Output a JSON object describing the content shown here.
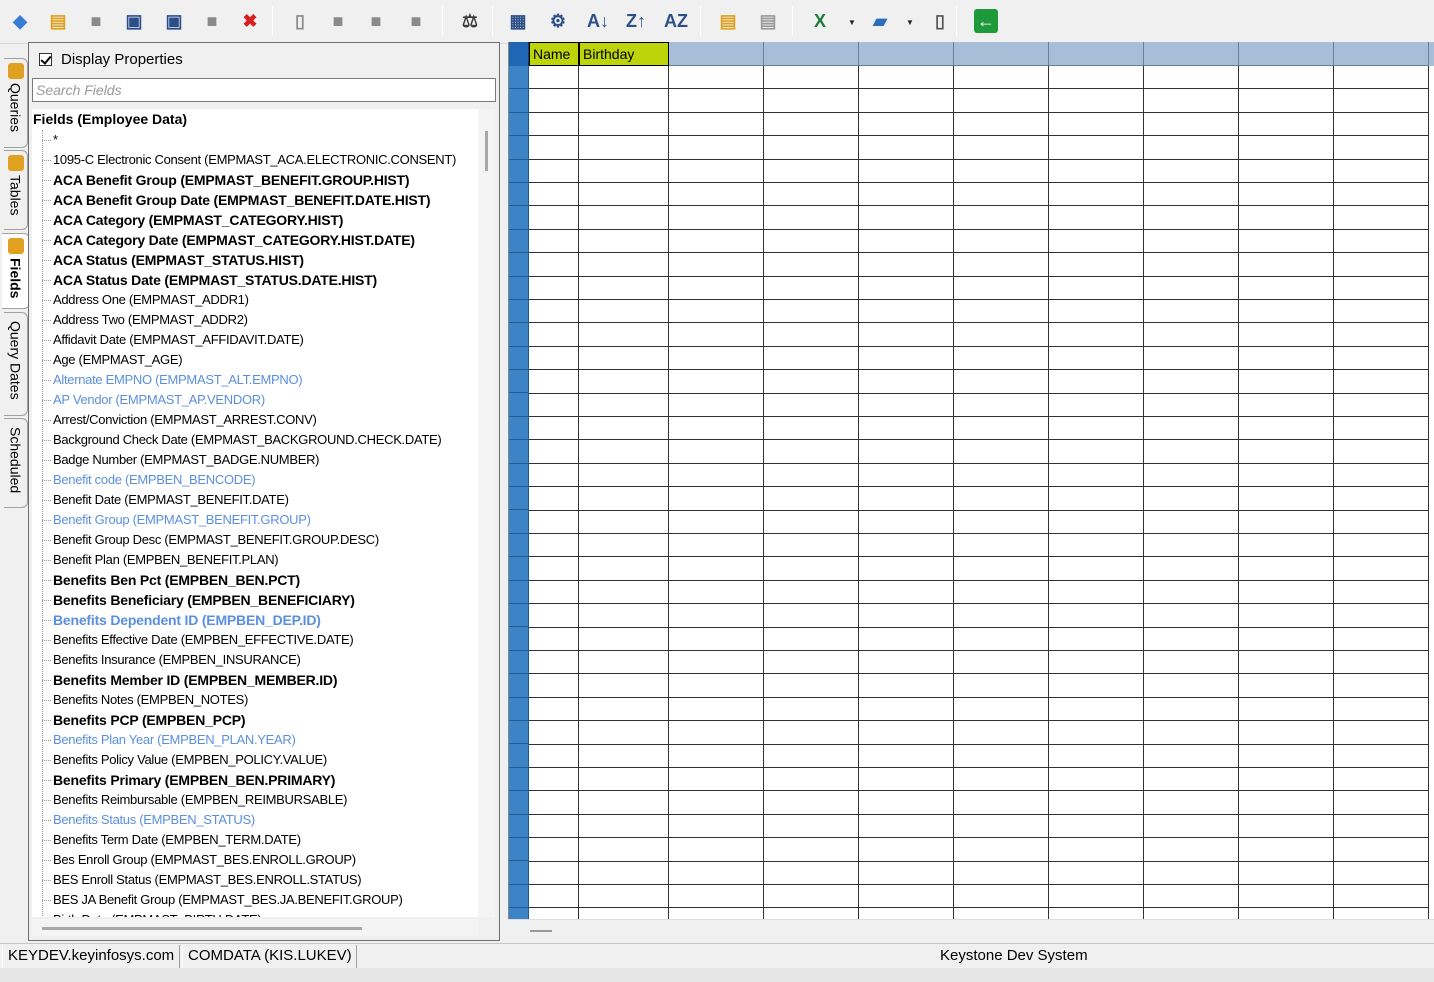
{
  "toolbar": {
    "buttons": [
      {
        "name": "open-query-icon",
        "glyph": "◆",
        "color": "#3a7bd5"
      },
      {
        "name": "database-add-icon",
        "glyph": "▤",
        "color": "#e0a020"
      },
      {
        "name": "folder-icon",
        "glyph": "■",
        "color": "#8a8a8a"
      },
      {
        "name": "save-icon",
        "glyph": "▣",
        "color": "#2c4f8a"
      },
      {
        "name": "save-as-icon",
        "glyph": "▣",
        "color": "#2c4f8a"
      },
      {
        "name": "disabled-icon",
        "glyph": "■",
        "color": "#8a8a8a"
      },
      {
        "name": "delete-icon",
        "glyph": "✖",
        "color": "#d82020"
      },
      {
        "name": "new-document-icon",
        "glyph": "▯",
        "color": "#8a8a8a"
      },
      {
        "name": "copy-icon",
        "glyph": "■",
        "color": "#8a8a8a"
      },
      {
        "name": "paste-icon",
        "glyph": "■",
        "color": "#8a8a8a"
      },
      {
        "name": "edit-document-icon",
        "glyph": "■",
        "color": "#8a8a8a"
      },
      {
        "name": "scales-icon",
        "glyph": "⚖",
        "color": "#3a3a3a"
      },
      {
        "name": "edit-grid-icon",
        "glyph": "▦",
        "color": "#2c4f8a"
      },
      {
        "name": "settings-gear-icon",
        "glyph": "⚙",
        "color": "#2c4f8a"
      },
      {
        "name": "sort-ascending-icon",
        "glyph": "A↓",
        "color": "#2c4f8a"
      },
      {
        "name": "sort-descending-icon",
        "glyph": "Z↑",
        "color": "#2c4f8a"
      },
      {
        "name": "sort-columns-icon",
        "glyph": "AZ",
        "color": "#2c4f8a"
      },
      {
        "name": "database-gold-icon",
        "glyph": "▤",
        "color": "#e0a020"
      },
      {
        "name": "database-grey-icon",
        "glyph": "▤",
        "color": "#9a9a9a"
      },
      {
        "name": "excel-export-icon",
        "glyph": "X",
        "color": "#1f7a3a"
      },
      {
        "name": "report-icon",
        "glyph": "▰",
        "color": "#2c6fb8"
      },
      {
        "name": "html-export-icon",
        "glyph": "▯",
        "color": "#555555"
      },
      {
        "name": "exit-icon",
        "glyph": "←",
        "color": "#ffffff",
        "bg": "#1f9a3a"
      }
    ]
  },
  "side_tabs": [
    {
      "label": "Queries",
      "icon_color": "#e0a020",
      "active": false
    },
    {
      "label": "Tables",
      "icon_color": "#e0a020",
      "active": false
    },
    {
      "label": "Fields",
      "icon_color": "#e0a020",
      "active": true
    },
    {
      "label": "Query Dates",
      "icon_color": "",
      "active": false
    },
    {
      "label": "Scheduled",
      "icon_color": "",
      "active": false
    }
  ],
  "left_panel": {
    "display_properties_label": "Display Properties",
    "display_properties_checked": true,
    "search_placeholder": "Search Fields",
    "search_value": "",
    "tree_root": "Fields (Employee Data)",
    "fields": [
      {
        "text": "*",
        "style": "normal"
      },
      {
        "text": "1095-C Electronic Consent (EMPMAST_ACA.ELECTRONIC.CONSENT)",
        "style": "normal"
      },
      {
        "text": "ACA Benefit Group (EMPMAST_BENEFIT.GROUP.HIST)",
        "style": "bold"
      },
      {
        "text": "ACA Benefit Group Date (EMPMAST_BENEFIT.DATE.HIST)",
        "style": "bold"
      },
      {
        "text": "ACA Category (EMPMAST_CATEGORY.HIST)",
        "style": "bold"
      },
      {
        "text": "ACA Category Date (EMPMAST_CATEGORY.HIST.DATE)",
        "style": "bold"
      },
      {
        "text": "ACA Status (EMPMAST_STATUS.HIST)",
        "style": "bold"
      },
      {
        "text": "ACA Status Date (EMPMAST_STATUS.DATE.HIST)",
        "style": "bold"
      },
      {
        "text": "Address One (EMPMAST_ADDR1)",
        "style": "normal"
      },
      {
        "text": "Address Two (EMPMAST_ADDR2)",
        "style": "normal"
      },
      {
        "text": "Affidavit Date (EMPMAST_AFFIDAVIT.DATE)",
        "style": "normal"
      },
      {
        "text": "Age (EMPMAST_AGE)",
        "style": "normal"
      },
      {
        "text": "Alternate EMPNO (EMPMAST_ALT.EMPNO)",
        "style": "blue"
      },
      {
        "text": "AP Vendor (EMPMAST_AP.VENDOR)",
        "style": "blue"
      },
      {
        "text": "Arrest/Conviction (EMPMAST_ARREST.CONV)",
        "style": "normal"
      },
      {
        "text": "Background Check Date (EMPMAST_BACKGROUND.CHECK.DATE)",
        "style": "normal"
      },
      {
        "text": "Badge Number (EMPMAST_BADGE.NUMBER)",
        "style": "normal"
      },
      {
        "text": "Benefit code (EMPBEN_BENCODE)",
        "style": "blue"
      },
      {
        "text": "Benefit Date (EMPMAST_BENEFIT.DATE)",
        "style": "normal"
      },
      {
        "text": "Benefit Group (EMPMAST_BENEFIT.GROUP)",
        "style": "blue"
      },
      {
        "text": "Benefit Group Desc (EMPMAST_BENEFIT.GROUP.DESC)",
        "style": "normal"
      },
      {
        "text": "Benefit Plan (EMPBEN_BENEFIT.PLAN)",
        "style": "normal"
      },
      {
        "text": "Benefits Ben Pct (EMPBEN_BEN.PCT)",
        "style": "bold"
      },
      {
        "text": "Benefits Beneficiary (EMPBEN_BENEFICIARY)",
        "style": "bold"
      },
      {
        "text": "Benefits Dependent ID (EMPBEN_DEP.ID)",
        "style": "bold blue"
      },
      {
        "text": "Benefits Effective Date (EMPBEN_EFFECTIVE.DATE)",
        "style": "normal"
      },
      {
        "text": "Benefits Insurance (EMPBEN_INSURANCE)",
        "style": "normal"
      },
      {
        "text": "Benefits Member ID (EMPBEN_MEMBER.ID)",
        "style": "bold"
      },
      {
        "text": "Benefits Notes (EMPBEN_NOTES)",
        "style": "normal"
      },
      {
        "text": "Benefits PCP (EMPBEN_PCP)",
        "style": "bold"
      },
      {
        "text": "Benefits Plan Year (EMPBEN_PLAN.YEAR)",
        "style": "blue"
      },
      {
        "text": "Benefits Policy Value (EMPBEN_POLICY.VALUE)",
        "style": "normal"
      },
      {
        "text": "Benefits Primary (EMPBEN_BEN.PRIMARY)",
        "style": "bold"
      },
      {
        "text": "Benefits Reimbursable (EMPBEN_REIMBURSABLE)",
        "style": "normal"
      },
      {
        "text": "Benefits Status (EMPBEN_STATUS)",
        "style": "blue"
      },
      {
        "text": "Benefits Term Date (EMPBEN_TERM.DATE)",
        "style": "normal"
      },
      {
        "text": "Bes Enroll Group (EMPMAST_BES.ENROLL.GROUP)",
        "style": "normal"
      },
      {
        "text": "BES Enroll Status (EMPMAST_BES.ENROLL.STATUS)",
        "style": "normal"
      },
      {
        "text": "BES JA Benefit Group (EMPMAST_BES.JA.BENEFIT.GROUP)",
        "style": "normal"
      },
      {
        "text": "Birth Date (EMPMAST_BIRTH.DATE)",
        "style": "normal"
      }
    ]
  },
  "grid": {
    "columns": [
      "Name",
      "Birthday",
      "",
      "",
      "",
      "",
      "",
      "",
      "",
      ""
    ],
    "named_column_color": "#bcd408",
    "header_color": "#a8bed8",
    "row_selector_color": "#3d84c6"
  },
  "status_bar": {
    "server": "KEYDEV.keyinfosys.com",
    "account": "COMDATA (KIS.LUKEV)",
    "system": "Keystone Dev System"
  }
}
